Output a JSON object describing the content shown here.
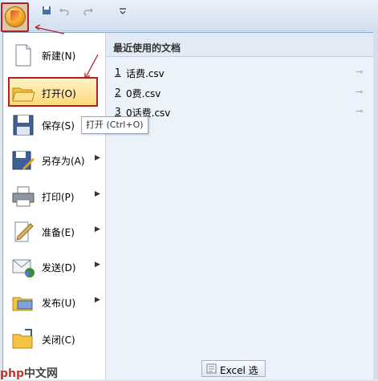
{
  "recent": {
    "title": "最近使用的文档",
    "items": [
      {
        "num": "1",
        "name": "话费.csv"
      },
      {
        "num": "2",
        "name": "0费.csv"
      },
      {
        "num": "3",
        "name": "0话费.csv"
      }
    ]
  },
  "menu": {
    "items": [
      {
        "label": "新建(N)",
        "icon": "new-document-icon",
        "submenu": false
      },
      {
        "label": "打开(O)",
        "icon": "open-folder-icon",
        "submenu": false
      },
      {
        "label": "保存(S)",
        "icon": "save-disk-icon",
        "submenu": false
      },
      {
        "label": "另存为(A)",
        "icon": "save-as-icon",
        "submenu": true
      },
      {
        "label": "打印(P)",
        "icon": "printer-icon",
        "submenu": true
      },
      {
        "label": "准备(E)",
        "icon": "prepare-pencil-icon",
        "submenu": true
      },
      {
        "label": "发送(D)",
        "icon": "send-envelope-icon",
        "submenu": true
      },
      {
        "label": "发布(U)",
        "icon": "publish-folder-icon",
        "submenu": true
      },
      {
        "label": "关闭(C)",
        "icon": "close-folder-icon",
        "submenu": false
      }
    ]
  },
  "tooltip": {
    "text": "打开 (Ctrl+O)"
  },
  "bottom": {
    "excel_options": "Excel 选"
  },
  "watermark": {
    "logo": "php",
    "text": "中文网"
  },
  "colors": {
    "highlight": "#b3202a",
    "hover": "#fdd97a",
    "accent": "#f4a623"
  }
}
